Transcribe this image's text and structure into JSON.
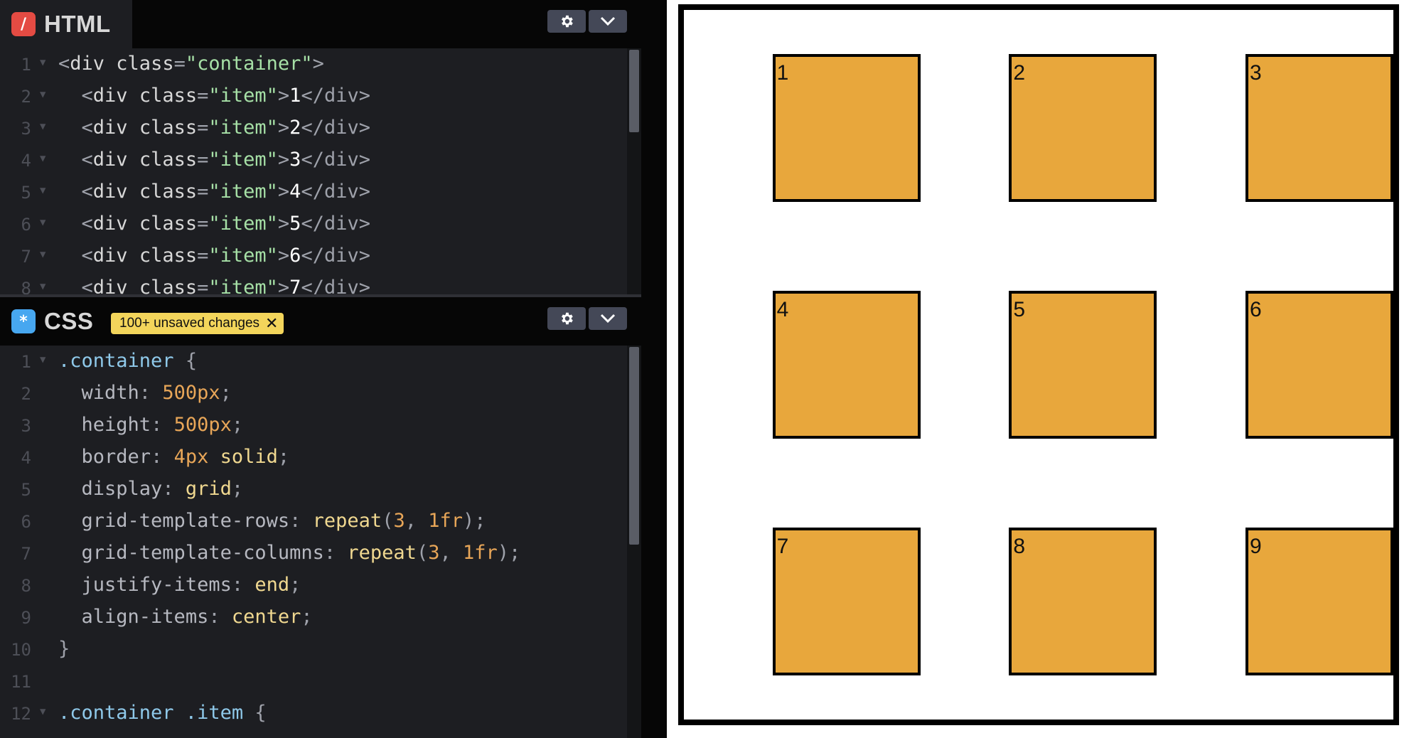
{
  "html_pane": {
    "title": "HTML",
    "icon": "/",
    "lines": [
      {
        "n": "1",
        "fold": true,
        "indent": "",
        "tokens": [
          [
            "t-punc",
            "<"
          ],
          [
            "t-tag",
            "div "
          ],
          [
            "t-attr",
            "class"
          ],
          [
            "t-punc",
            "="
          ],
          [
            "t-str",
            "\"container\""
          ],
          [
            "t-punc",
            ">"
          ]
        ]
      },
      {
        "n": "2",
        "fold": true,
        "indent": "  ",
        "tokens": [
          [
            "t-punc",
            "<"
          ],
          [
            "t-tag",
            "div "
          ],
          [
            "t-attr",
            "class"
          ],
          [
            "t-punc",
            "="
          ],
          [
            "t-str",
            "\"item\""
          ],
          [
            "t-punc",
            ">"
          ],
          [
            "t-text",
            "1"
          ],
          [
            "t-punc",
            "</div>"
          ]
        ]
      },
      {
        "n": "3",
        "fold": true,
        "indent": "  ",
        "tokens": [
          [
            "t-punc",
            "<"
          ],
          [
            "t-tag",
            "div "
          ],
          [
            "t-attr",
            "class"
          ],
          [
            "t-punc",
            "="
          ],
          [
            "t-str",
            "\"item\""
          ],
          [
            "t-punc",
            ">"
          ],
          [
            "t-text",
            "2"
          ],
          [
            "t-punc",
            "</div>"
          ]
        ]
      },
      {
        "n": "4",
        "fold": true,
        "indent": "  ",
        "tokens": [
          [
            "t-punc",
            "<"
          ],
          [
            "t-tag",
            "div "
          ],
          [
            "t-attr",
            "class"
          ],
          [
            "t-punc",
            "="
          ],
          [
            "t-str",
            "\"item\""
          ],
          [
            "t-punc",
            ">"
          ],
          [
            "t-text",
            "3"
          ],
          [
            "t-punc",
            "</div>"
          ]
        ]
      },
      {
        "n": "5",
        "fold": true,
        "indent": "  ",
        "tokens": [
          [
            "t-punc",
            "<"
          ],
          [
            "t-tag",
            "div "
          ],
          [
            "t-attr",
            "class"
          ],
          [
            "t-punc",
            "="
          ],
          [
            "t-str",
            "\"item\""
          ],
          [
            "t-punc",
            ">"
          ],
          [
            "t-text",
            "4"
          ],
          [
            "t-punc",
            "</div>"
          ]
        ]
      },
      {
        "n": "6",
        "fold": true,
        "indent": "  ",
        "tokens": [
          [
            "t-punc",
            "<"
          ],
          [
            "t-tag",
            "div "
          ],
          [
            "t-attr",
            "class"
          ],
          [
            "t-punc",
            "="
          ],
          [
            "t-str",
            "\"item\""
          ],
          [
            "t-punc",
            ">"
          ],
          [
            "t-text",
            "5"
          ],
          [
            "t-punc",
            "</div>"
          ]
        ]
      },
      {
        "n": "7",
        "fold": true,
        "indent": "  ",
        "tokens": [
          [
            "t-punc",
            "<"
          ],
          [
            "t-tag",
            "div "
          ],
          [
            "t-attr",
            "class"
          ],
          [
            "t-punc",
            "="
          ],
          [
            "t-str",
            "\"item\""
          ],
          [
            "t-punc",
            ">"
          ],
          [
            "t-text",
            "6"
          ],
          [
            "t-punc",
            "</div>"
          ]
        ]
      },
      {
        "n": "8",
        "fold": true,
        "indent": "  ",
        "tokens": [
          [
            "t-punc",
            "<"
          ],
          [
            "t-tag",
            "div "
          ],
          [
            "t-attr",
            "class"
          ],
          [
            "t-punc",
            "="
          ],
          [
            "t-str",
            "\"item\""
          ],
          [
            "t-punc",
            ">"
          ],
          [
            "t-text",
            "7"
          ],
          [
            "t-punc",
            "</div>"
          ]
        ]
      }
    ]
  },
  "css_pane": {
    "title": "CSS",
    "icon": "*",
    "badge": "100+ unsaved changes",
    "lines": [
      {
        "n": "1",
        "fold": true,
        "indent": "",
        "tokens": [
          [
            "t-sel",
            ".container"
          ],
          [
            "t-punc",
            " {"
          ]
        ]
      },
      {
        "n": "2",
        "fold": false,
        "indent": "  ",
        "tokens": [
          [
            "t-prop",
            "width"
          ],
          [
            "t-punc",
            ": "
          ],
          [
            "t-num",
            "500px"
          ],
          [
            "t-punc",
            ";"
          ]
        ]
      },
      {
        "n": "3",
        "fold": false,
        "indent": "  ",
        "tokens": [
          [
            "t-prop",
            "height"
          ],
          [
            "t-punc",
            ": "
          ],
          [
            "t-num",
            "500px"
          ],
          [
            "t-punc",
            ";"
          ]
        ]
      },
      {
        "n": "4",
        "fold": false,
        "indent": "  ",
        "tokens": [
          [
            "t-prop",
            "border"
          ],
          [
            "t-punc",
            ": "
          ],
          [
            "t-num",
            "4px"
          ],
          [
            "t-kw",
            " solid"
          ],
          [
            "t-punc",
            ";"
          ]
        ]
      },
      {
        "n": "5",
        "fold": false,
        "indent": "  ",
        "tokens": [
          [
            "t-prop",
            "display"
          ],
          [
            "t-punc",
            ": "
          ],
          [
            "t-kw",
            "grid"
          ],
          [
            "t-punc",
            ";"
          ]
        ]
      },
      {
        "n": "6",
        "fold": false,
        "indent": "  ",
        "tokens": [
          [
            "t-prop",
            "grid-template-rows"
          ],
          [
            "t-punc",
            ": "
          ],
          [
            "t-kw",
            "repeat"
          ],
          [
            "t-punc",
            "("
          ],
          [
            "t-num",
            "3"
          ],
          [
            "t-punc",
            ", "
          ],
          [
            "t-num",
            "1fr"
          ],
          [
            "t-punc",
            ");"
          ]
        ]
      },
      {
        "n": "7",
        "fold": false,
        "indent": "  ",
        "tokens": [
          [
            "t-prop",
            "grid-template-columns"
          ],
          [
            "t-punc",
            ": "
          ],
          [
            "t-kw",
            "repeat"
          ],
          [
            "t-punc",
            "("
          ],
          [
            "t-num",
            "3"
          ],
          [
            "t-punc",
            ", "
          ],
          [
            "t-num",
            "1fr"
          ],
          [
            "t-punc",
            ");"
          ]
        ]
      },
      {
        "n": "8",
        "fold": false,
        "indent": "  ",
        "tokens": [
          [
            "t-prop",
            "justify-items"
          ],
          [
            "t-punc",
            ": "
          ],
          [
            "t-kw",
            "end"
          ],
          [
            "t-punc",
            ";"
          ]
        ]
      },
      {
        "n": "9",
        "fold": false,
        "indent": "  ",
        "tokens": [
          [
            "t-prop",
            "align-items"
          ],
          [
            "t-punc",
            ": "
          ],
          [
            "t-kw",
            "center"
          ],
          [
            "t-punc",
            ";"
          ]
        ]
      },
      {
        "n": "10",
        "fold": false,
        "indent": "",
        "tokens": [
          [
            "t-punc",
            "}"
          ]
        ]
      },
      {
        "n": "11",
        "fold": false,
        "indent": "",
        "tokens": []
      },
      {
        "n": "12",
        "fold": true,
        "indent": "",
        "tokens": [
          [
            "t-sel",
            ".container .item"
          ],
          [
            "t-punc",
            " {"
          ]
        ]
      }
    ]
  },
  "preview": {
    "items": [
      "1",
      "2",
      "3",
      "4",
      "5",
      "6",
      "7",
      "8",
      "9"
    ]
  },
  "colors": {
    "item_fill": "#e8a73c",
    "editor_bg": "#1d1e22",
    "badge": "#f3d55b"
  }
}
